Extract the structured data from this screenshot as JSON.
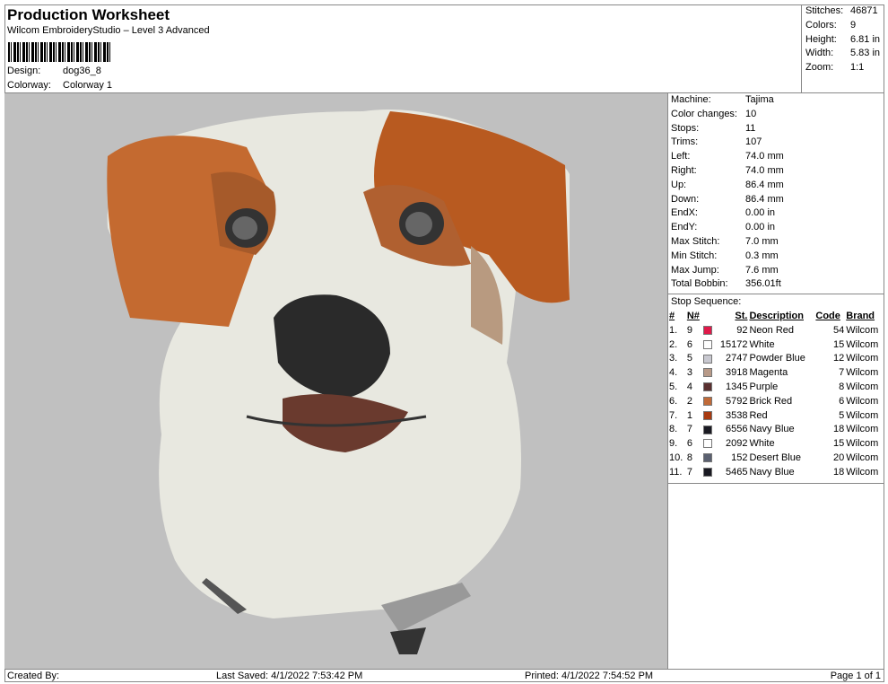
{
  "header": {
    "title": "Production Worksheet",
    "subtitle": "Wilcom EmbroideryStudio – Level 3 Advanced",
    "design_label": "Design:",
    "design": "dog36_8",
    "colorway_label": "Colorway:",
    "colorway": "Colorway 1"
  },
  "stats": [
    {
      "k": "Stitches:",
      "v": "46871"
    },
    {
      "k": "Colors:",
      "v": "9"
    },
    {
      "k": "Height:",
      "v": "6.81 in"
    },
    {
      "k": "Width:",
      "v": "5.83 in"
    },
    {
      "k": "Zoom:",
      "v": "1:1"
    }
  ],
  "info": [
    {
      "k": "Machine:",
      "v": "Tajima"
    },
    {
      "k": "Color changes:",
      "v": "10"
    },
    {
      "k": "Stops:",
      "v": "11"
    },
    {
      "k": "Trims:",
      "v": "107"
    },
    {
      "k": "Left:",
      "v": "74.0 mm"
    },
    {
      "k": "Right:",
      "v": "74.0 mm"
    },
    {
      "k": "Up:",
      "v": "86.4 mm"
    },
    {
      "k": "Down:",
      "v": "86.4 mm"
    },
    {
      "k": "EndX:",
      "v": "0.00 in"
    },
    {
      "k": "EndY:",
      "v": "0.00 in"
    },
    {
      "k": "Max Stitch:",
      "v": "7.0 mm"
    },
    {
      "k": "Min Stitch:",
      "v": "0.3 mm"
    },
    {
      "k": "Max Jump:",
      "v": "7.6 mm"
    },
    {
      "k": "Total Bobbin:",
      "v": "356.01ft"
    }
  ],
  "stop_sequence": {
    "label": "Stop Sequence:",
    "headers": [
      "#",
      "N#",
      "St.",
      "Description",
      "Code",
      "Brand"
    ],
    "rows": [
      [
        "1.",
        "9",
        "92",
        "Neon Red",
        "54",
        "Wilcom",
        "#e0194a"
      ],
      [
        "2.",
        "6",
        "15172",
        "White",
        "15",
        "Wilcom",
        "#ffffff"
      ],
      [
        "3.",
        "5",
        "2747",
        "Powder Blue",
        "12",
        "Wilcom",
        "#c8c8d0"
      ],
      [
        "4.",
        "3",
        "3918",
        "Magenta",
        "7",
        "Wilcom",
        "#b89a88"
      ],
      [
        "5.",
        "4",
        "1345",
        "Purple",
        "8",
        "Wilcom",
        "#5a3030"
      ],
      [
        "6.",
        "2",
        "5792",
        "Brick Red",
        "6",
        "Wilcom",
        "#c06a38"
      ],
      [
        "7.",
        "1",
        "3538",
        "Red",
        "5",
        "Wilcom",
        "#a83a10"
      ],
      [
        "8.",
        "7",
        "6556",
        "Navy Blue",
        "18",
        "Wilcom",
        "#1a1a22"
      ],
      [
        "9.",
        "6",
        "2092",
        "White",
        "15",
        "Wilcom",
        "#ffffff"
      ],
      [
        "10.",
        "8",
        "152",
        "Desert Blue",
        "20",
        "Wilcom",
        "#5a6070"
      ],
      [
        "11.",
        "7",
        "5465",
        "Navy Blue",
        "18",
        "Wilcom",
        "#1a1a22"
      ]
    ]
  },
  "footer": {
    "created": "Created By:",
    "saved": "Last Saved: 4/1/2022 7:53:42 PM",
    "printed": "Printed: 4/1/2022 7:54:52 PM",
    "page": "Page 1 of 1"
  }
}
